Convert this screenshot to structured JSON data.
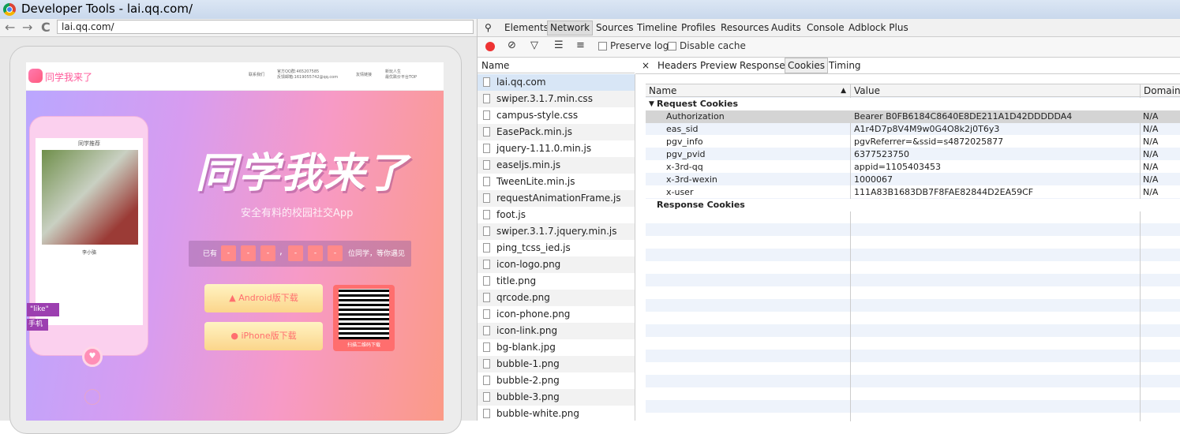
{
  "window": {
    "title": "Developer Tools - lai.qq.com/"
  },
  "browser": {
    "url": "lai.qq.com/",
    "back": "←",
    "forward": "→",
    "reload": "C"
  },
  "site": {
    "brand": "同学我来了",
    "header_contact": "联系我们",
    "header_qq": "官方QQ群:465207585",
    "header_email": "反馈邮箱:1619055742@qq.com",
    "header_link": "友情链接",
    "header_slogan1": "新玩人生",
    "header_slogan2": "最优跌价平台TOP",
    "title": "同学我来了",
    "subtitle": "安全有料的校园社交App",
    "counter_prefix": "已有",
    "counter_suffix": "位同学，等你遇见",
    "counter_digits": [
      "-",
      "-",
      "-",
      "-",
      "-",
      "-"
    ],
    "counter_sep": ",",
    "android_btn": "Android版下载",
    "iphone_btn": "iPhone版下载",
    "qr_caption": "扫描二维码下载",
    "phone_screen_title": "同学推荐",
    "phone_like1": "\"like\"",
    "phone_like2": "手机",
    "phone_card_name": "李小骆"
  },
  "devtools": {
    "tabs": [
      "Elements",
      "Network",
      "Sources",
      "Timeline",
      "Profiles",
      "Resources",
      "Audits",
      "Console",
      "Adblock Plus"
    ],
    "selected_tab": "Network",
    "preserve_log": "Preserve log",
    "disable_cache": "Disable cache",
    "list_header": "Name",
    "requests": [
      "lai.qq.com",
      "swiper.3.1.7.min.css",
      "campus-style.css",
      "EasePack.min.js",
      "jquery-1.11.0.min.js",
      "easeljs.min.js",
      "TweenLite.min.js",
      "requestAnimationFrame.js",
      "foot.js",
      "swiper.3.1.7.jquery.min.js",
      "ping_tcss_ied.js",
      "icon-logo.png",
      "title.png",
      "qrcode.png",
      "icon-phone.png",
      "icon-link.png",
      "bg-blank.jpg",
      "bubble-1.png",
      "bubble-2.png",
      "bubble-3.png",
      "bubble-white.png"
    ],
    "detail_close": "×",
    "detail_tabs": [
      "Headers",
      "Preview",
      "Response",
      "Cookies",
      "Timing"
    ],
    "detail_selected": "Cookies",
    "cookies": {
      "col_name": "Name",
      "col_value": "Value",
      "col_domain": "Domain",
      "request_section": "Request Cookies",
      "response_section": "Response Cookies",
      "rows": [
        {
          "name": "Authorization",
          "value": "Bearer B0FB6184C8640E8DE211A1D42DDDDDA4",
          "domain": "N/A"
        },
        {
          "name": "eas_sid",
          "value": "A1r4D7p8V4M9w0G4O8k2j0T6y3",
          "domain": "N/A"
        },
        {
          "name": "pgv_info",
          "value": "pgvReferrer=&ssid=s4872025877",
          "domain": "N/A"
        },
        {
          "name": "pgv_pvid",
          "value": "6377523750",
          "domain": "N/A"
        },
        {
          "name": "x-3rd-qq",
          "value": "appid=1105403453",
          "domain": "N/A"
        },
        {
          "name": "x-3rd-wexin",
          "value": "1000067",
          "domain": "N/A"
        },
        {
          "name": "x-user",
          "value": "111A83B1683DB7F8FAE82844D2EA59CF",
          "domain": "N/A"
        }
      ]
    }
  }
}
